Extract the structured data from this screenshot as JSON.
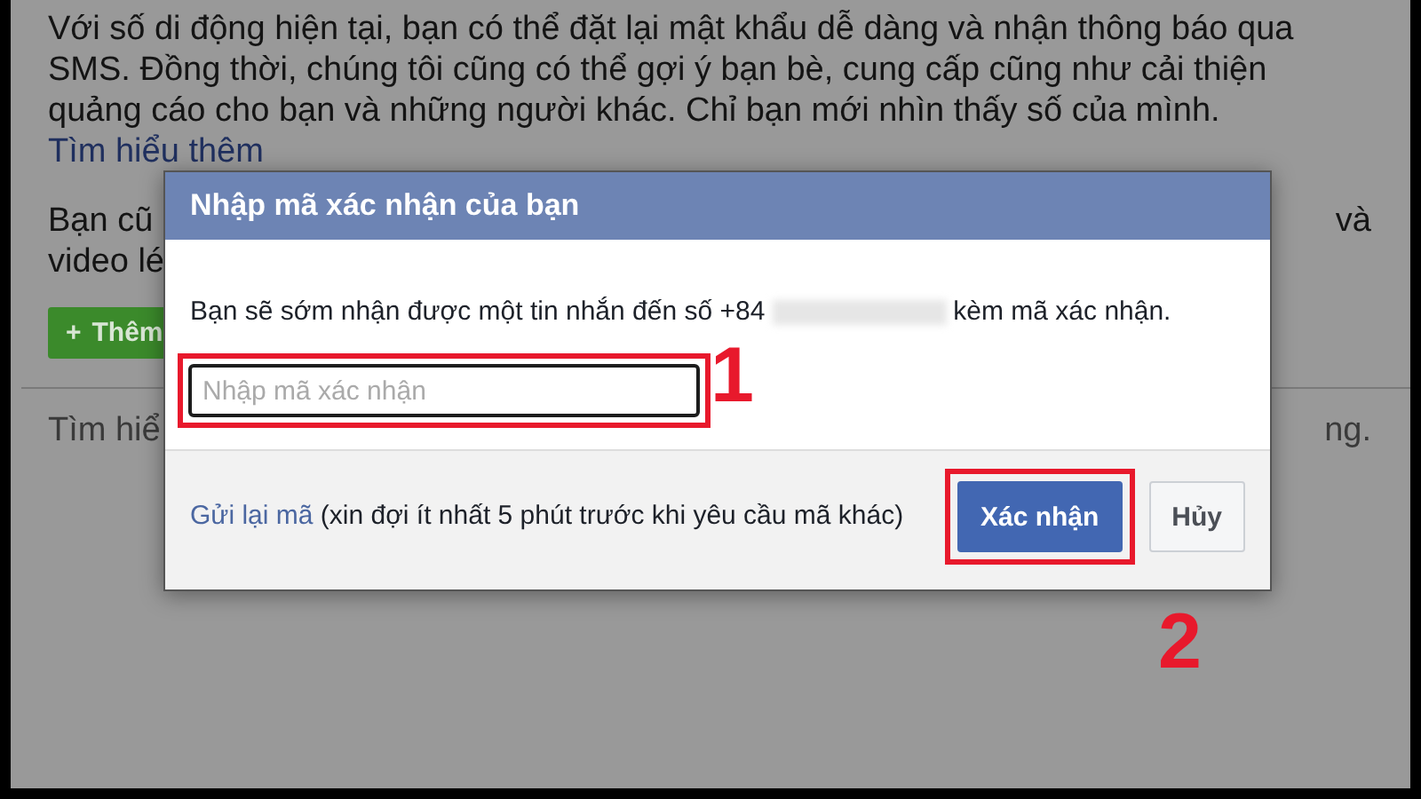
{
  "page": {
    "intro": "Với số di động hiện tại, bạn có thể đặt lại mật khẩu dễ dàng và nhận thông báo qua SMS. Đồng thời, chúng tôi cũng có thể gợi ý bạn bè, cung cấp cũng như cải thiện quảng cáo cho bạn và những người khác. Chỉ bạn mới nhìn thấy số của mình.",
    "learn_more_link": "Tìm hiểu thêm",
    "line_2_left": "Bạn cũ",
    "line_2_right": "và",
    "line_3_left": "video lé",
    "add_button": {
      "icon": "+",
      "label": "Thêm"
    },
    "footer_left": "Tìm hiể",
    "footer_right": "ng."
  },
  "dialog": {
    "title": "Nhập mã xác nhận của bạn",
    "message_before": "Bạn sẽ sớm nhận được một tin nhắn đến số +84",
    "message_after": "kèm mã xác nhận.",
    "code_field": {
      "placeholder": "Nhập mã xác nhận"
    },
    "resend_link": "Gửi lại mã",
    "resend_note": "(xin đợi ít nhất 5 phút trước khi yêu cầu mã khác)",
    "buttons": [
      {
        "label": "Xác nhận",
        "kind": "primary"
      },
      {
        "label": "Hủy",
        "kind": "secondary"
      }
    ]
  },
  "annotations": [
    {
      "label": "1"
    },
    {
      "label": "2"
    }
  ]
}
